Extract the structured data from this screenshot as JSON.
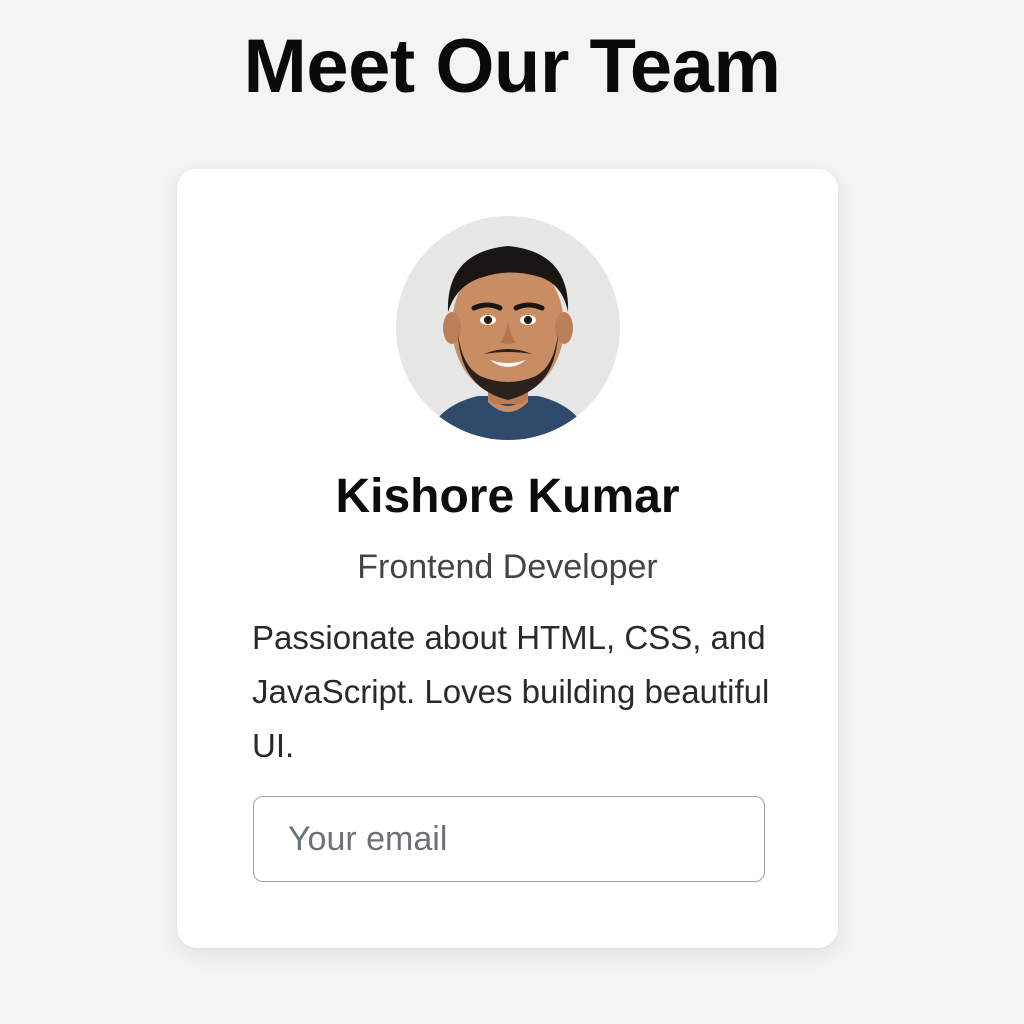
{
  "page": {
    "title": "Meet Our Team"
  },
  "card": {
    "name": "Kishore Kumar",
    "role": "Frontend Developer",
    "bio": "Passionate about HTML, CSS, and JavaScript. Loves building beautiful UI.",
    "email": {
      "value": "",
      "placeholder": "Your email"
    }
  },
  "colors": {
    "background": "#f4f4f4",
    "card": "#ffffff",
    "avatar_bg": "#e6e6e6",
    "input_border": "#9ea3a8"
  },
  "icons": {
    "avatar": "person-portrait"
  }
}
